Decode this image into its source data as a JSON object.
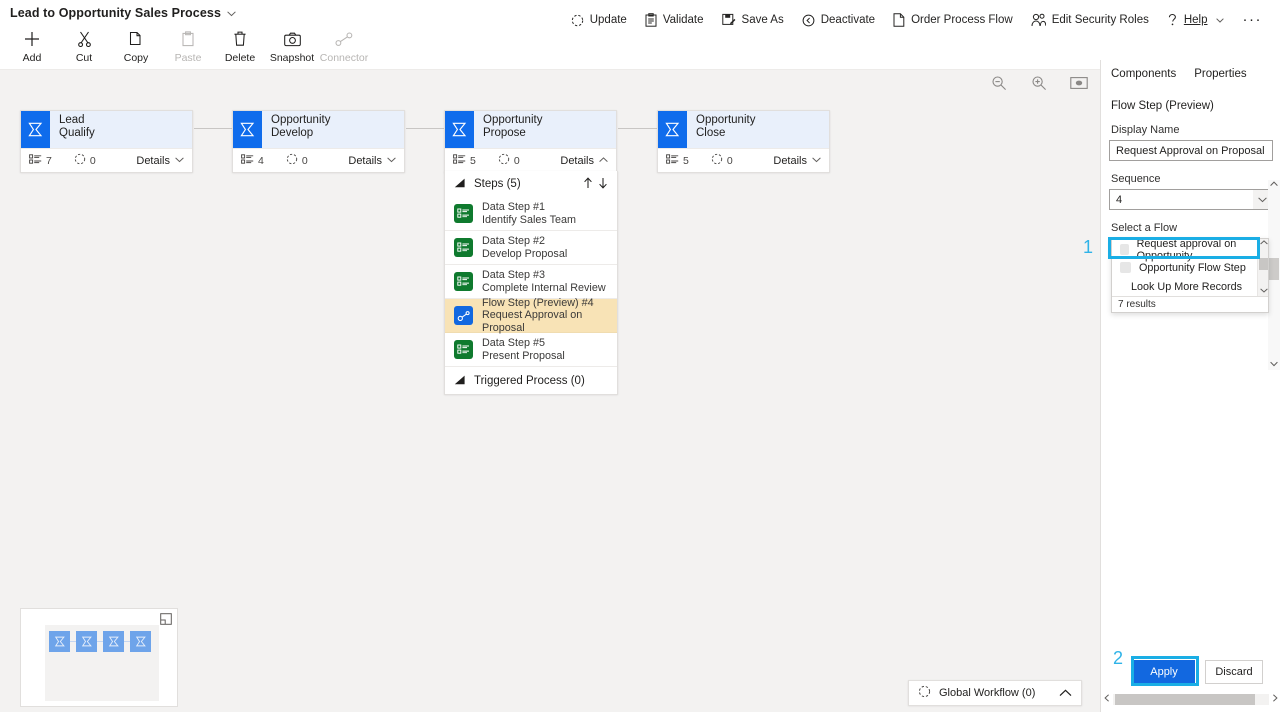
{
  "window": {
    "process_title": "Lead to Opportunity Sales Process",
    "title_chevron": "chevron-down-icon"
  },
  "command_bar": {
    "left_buttons": [
      {
        "label": "Add",
        "icon": "plus-icon",
        "disabled": false
      },
      {
        "label": "Cut",
        "icon": "scissors-icon",
        "disabled": false
      },
      {
        "label": "Copy",
        "icon": "copy-icon",
        "disabled": false
      },
      {
        "label": "Paste",
        "icon": "paste-icon",
        "disabled": true
      },
      {
        "label": "Delete",
        "icon": "trash-icon",
        "disabled": false
      },
      {
        "label": "Snapshot",
        "icon": "camera-icon",
        "disabled": false
      },
      {
        "label": "Connector",
        "icon": "connector-icon",
        "disabled": true
      }
    ],
    "right_buttons": [
      {
        "label": "Update",
        "icon": "refresh-icon"
      },
      {
        "label": "Validate",
        "icon": "clipboard-check-icon"
      },
      {
        "label": "Save As",
        "icon": "save-as-icon"
      },
      {
        "label": "Deactivate",
        "icon": "deactivate-icon"
      },
      {
        "label": "Order Process Flow",
        "icon": "document-icon"
      },
      {
        "label": "Edit Security Roles",
        "icon": "people-icon"
      },
      {
        "label": "Help",
        "icon": "question-icon",
        "chevron": true
      }
    ],
    "overflow_label": "···"
  },
  "canvas": {
    "zoom_tools": [
      {
        "name": "zoom-out-icon"
      },
      {
        "name": "zoom-in-icon"
      },
      {
        "name": "fit-to-screen-icon"
      }
    ],
    "stages": [
      {
        "entity": "Lead",
        "category": "Qualify",
        "steps_count": "7",
        "workflow_count": "0",
        "details_label": "Details",
        "expanded": false
      },
      {
        "entity": "Opportunity",
        "category": "Develop",
        "steps_count": "4",
        "workflow_count": "0",
        "details_label": "Details",
        "expanded": false
      },
      {
        "entity": "Opportunity",
        "category": "Propose",
        "steps_count": "5",
        "workflow_count": "0",
        "details_label": "Details",
        "expanded": true
      },
      {
        "entity": "Opportunity",
        "category": "Close",
        "steps_count": "5",
        "workflow_count": "0",
        "details_label": "Details",
        "expanded": false
      }
    ],
    "steps_panel": {
      "header": "Steps (5)",
      "move_up_icon": "arrow-up-icon",
      "move_down_icon": "arrow-down-icon",
      "steps": [
        {
          "title": "Data Step #1",
          "subtitle": "Identify Sales Team",
          "kind": "data",
          "selected": false
        },
        {
          "title": "Data Step #2",
          "subtitle": "Develop Proposal",
          "kind": "data",
          "selected": false
        },
        {
          "title": "Data Step #3",
          "subtitle": "Complete Internal Review",
          "kind": "data",
          "selected": false
        },
        {
          "title": "Flow Step (Preview) #4",
          "subtitle": "Request Approval on Proposal",
          "kind": "flow",
          "selected": true
        },
        {
          "title": "Data Step #5",
          "subtitle": "Present Proposal",
          "kind": "data",
          "selected": false
        }
      ],
      "triggered_header": "Triggered Process (0)"
    },
    "minimap": {
      "expand_icon": "expand-icon",
      "stage_count": 4
    },
    "global_workflow": {
      "label": "Global Workflow (0)",
      "icon": "workflow-icon",
      "chevron": "chevron-up-icon"
    }
  },
  "properties_panel": {
    "tabs": [
      {
        "label": "Components",
        "active": false
      },
      {
        "label": "Properties",
        "active": true
      }
    ],
    "section_title": "Flow Step (Preview)",
    "fields": {
      "display_name": {
        "label": "Display Name",
        "value": "Request Approval on Proposal",
        "placeholder": ""
      },
      "sequence": {
        "label": "Sequence",
        "value": "4"
      },
      "select_a_flow": {
        "label": "Select a Flow",
        "value": "Request approval on Opportunity",
        "placeholder": "",
        "search_icon": "search-icon"
      }
    },
    "dropdown": {
      "options": [
        {
          "label": "Request approval on Opportunity",
          "has_thumb": true,
          "highlighted": true
        },
        {
          "label": "Opportunity Flow Step",
          "has_thumb": true,
          "highlighted": false
        },
        {
          "label": "Look Up More Records",
          "has_thumb": false,
          "highlighted": false
        }
      ],
      "results_text": "7 results"
    },
    "actions": {
      "apply_label": "Apply",
      "discard_label": "Discard"
    }
  },
  "annotations": [
    {
      "number": "1",
      "target": "flow-dropdown-option"
    },
    {
      "number": "2",
      "target": "apply-button"
    }
  ],
  "colors": {
    "accent_blue": "#1268e0",
    "stage_icon_blue": "#0f6cec",
    "stage_header_blue": "#e9f0fb",
    "data_step_green": "#0f7a2e",
    "selected_step_amber": "#f8e3b6",
    "callout_cyan": "#1aaee5",
    "canvas_gray": "#f3f2f1"
  }
}
